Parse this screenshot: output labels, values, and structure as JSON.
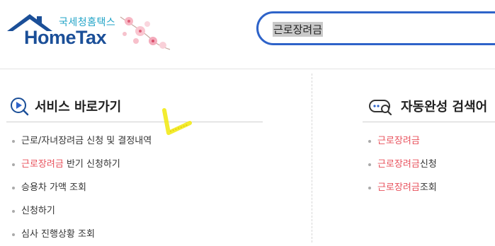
{
  "brand": {
    "korean": "국세청홈택스",
    "english": "HomeTax"
  },
  "search": {
    "query": "근로장려금"
  },
  "service_shortcuts": {
    "title": "서비스 바로가기",
    "items": [
      {
        "hl": "",
        "text": "근로/자녀장려금 신청 및 결정내역"
      },
      {
        "hl": "근로장려금",
        "text": " 반기 신청하기"
      },
      {
        "hl": "",
        "text": "승용차 가액 조회"
      },
      {
        "hl": "",
        "text": "신청하기"
      },
      {
        "hl": "",
        "text": "심사 진행상황 조회"
      }
    ]
  },
  "autocomplete": {
    "title": "자동완성 검색어",
    "items": [
      {
        "hl": "근로장려금",
        "text": ""
      },
      {
        "hl": "근로장려금",
        "text": "신청"
      },
      {
        "hl": "근로장려금",
        "text": "조회"
      }
    ]
  },
  "colors": {
    "accent_blue": "#2e63c9",
    "highlight_red": "#e8505b",
    "logo_blue": "#1b4f98"
  }
}
